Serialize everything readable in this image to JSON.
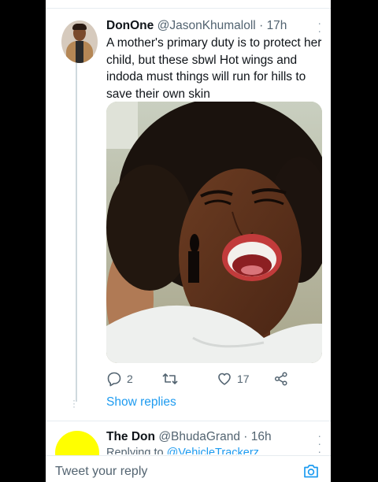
{
  "tweet": {
    "display_name": "DonOne",
    "handle": "@JasonKhumaloll",
    "separator": "·",
    "time": "17h",
    "text": "A mother's primary duty is to protect her child, but these sbwl Hot wings and indoda must things will run for hills to save their own skin",
    "media_icon": "photo-of-laughing-woman",
    "actions": {
      "reply_count": "2",
      "retweet_count": "",
      "like_count": "17"
    },
    "show_replies": "Show replies"
  },
  "next_tweet": {
    "display_name": "The Don",
    "handle": "@BhudaGrand",
    "separator": "·",
    "time": "16h",
    "replying_prefix": "Replying to",
    "replying_to": "@VehicleTrackerz"
  },
  "reply_bar": {
    "placeholder": "Tweet your reply"
  },
  "colors": {
    "accent": "#1d9bf0",
    "secondary_text": "#536471",
    "avatar_yellow": "#ffff00"
  }
}
